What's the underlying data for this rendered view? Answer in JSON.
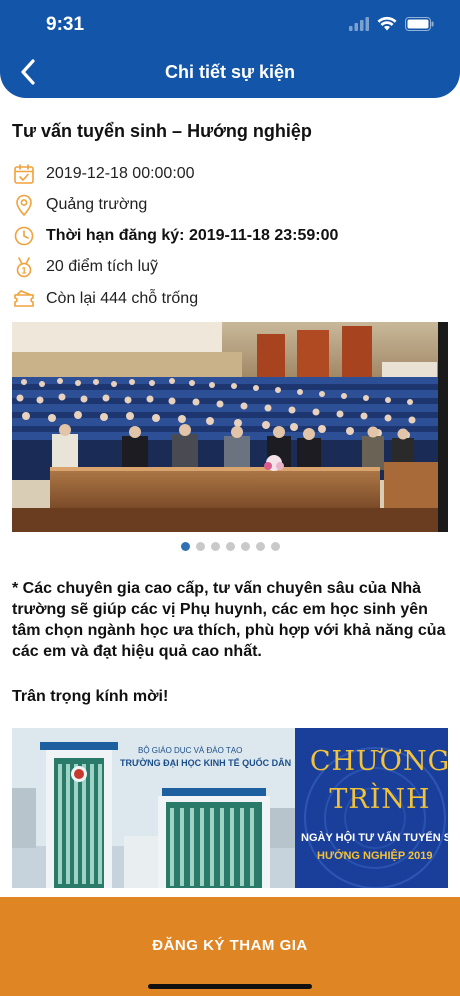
{
  "status_bar": {
    "time": "9:31"
  },
  "nav": {
    "title": "Chi tiết sự kiện"
  },
  "event": {
    "title": "Tư vấn tuyển sinh – Hướng nghiệp",
    "datetime": "2019-12-18 00:00:00",
    "location": "Quảng trường",
    "deadline": "Thời hạn đăng ký: 2019-11-18 23:59:00",
    "points": "20 điểm tích luỹ",
    "seats": "Còn lại 444 chỗ trống"
  },
  "carousel": {
    "slide_count": 7,
    "active_index": 0
  },
  "description": "* Các chuyên gia cao cấp, tư vấn chuyên sâu của Nhà trường sẽ giúp các vị Phụ huynh, các em học sinh yên tâm chọn ngành học ưa thích, phù hợp với khả năng của các em và đạt hiệu quả cao nhất.",
  "greeting": "Trân trọng kính mời!",
  "banner": {
    "org_line1": "BỘ GIÁO DỤC VÀ ĐÀO TẠO",
    "org_line2": "TRƯỜNG ĐẠI HỌC KINH TẾ QUỐC DÂN",
    "title_line1": "CHƯƠNG",
    "title_line2": "TRÌNH",
    "subtitle_line1": "NGÀY HỘI TƯ VẤN TUYỂN SI",
    "subtitle_line2": "HƯỚNG NGHIỆP 2019"
  },
  "footer": {
    "register_label": "ĐĂNG KÝ THAM GIA"
  },
  "colors": {
    "header_bg": "#1355a8",
    "accent_orange": "#e08524",
    "icon_orange": "#f0a23c",
    "dot_active": "#2f6fb3",
    "dot_inactive": "#c9c9c9"
  },
  "icons": {
    "back": "chevron-left-icon",
    "datetime": "calendar-check-icon",
    "location": "map-pin-icon",
    "deadline": "clock-icon",
    "points": "medal-icon",
    "seats": "ticket-icon"
  }
}
